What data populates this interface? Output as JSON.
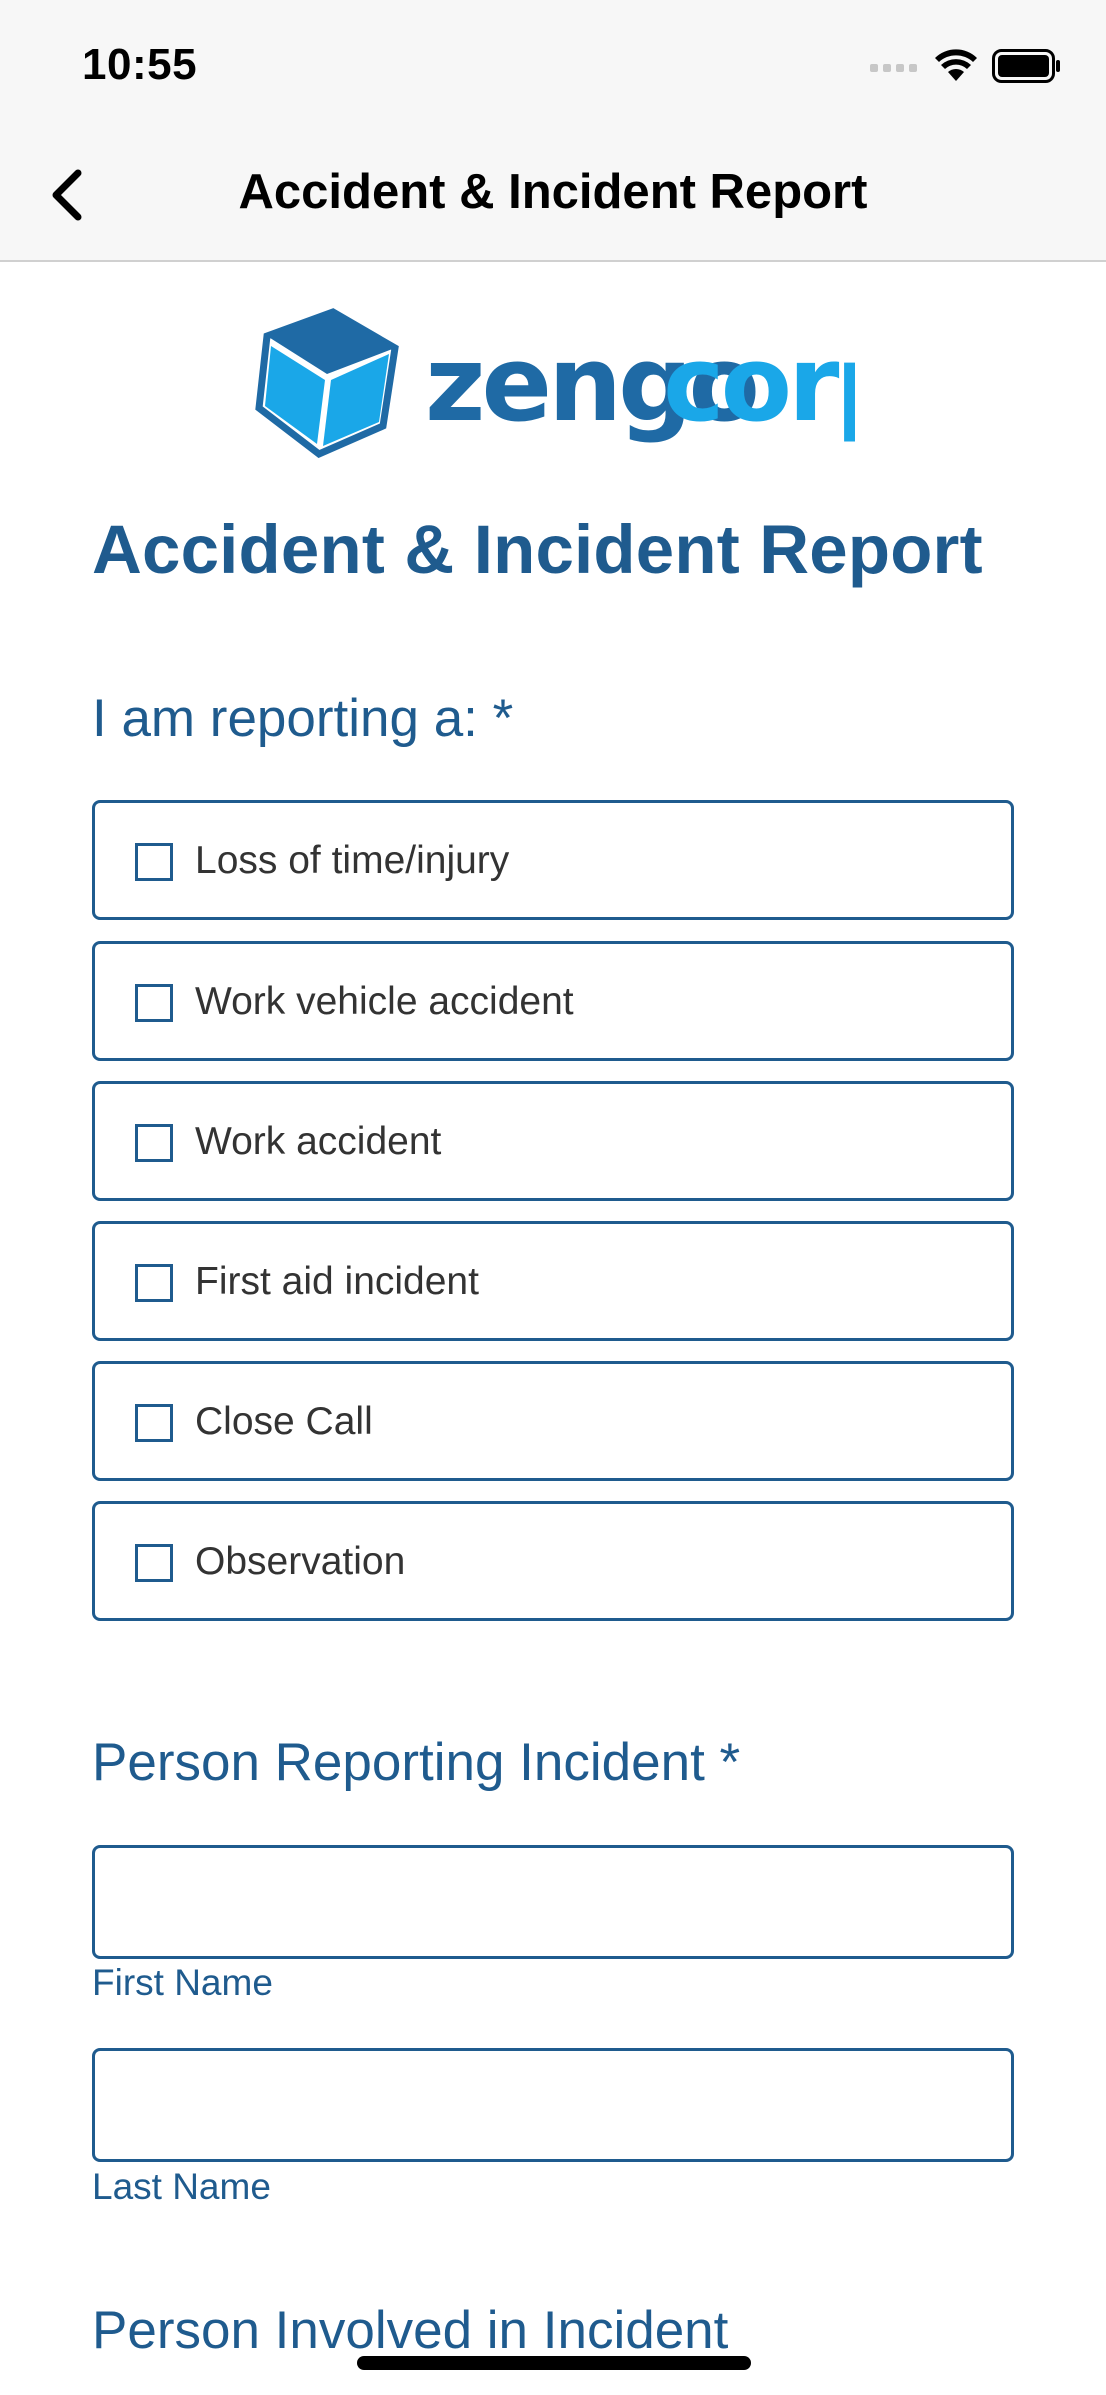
{
  "status": {
    "time": "10:55"
  },
  "nav": {
    "title": "Accident & Incident Report"
  },
  "logo": {
    "text_dark": "zengo",
    "text_light": "corp"
  },
  "colors": {
    "accent": "#1f5b8e",
    "logo_light": "#1aa7e8",
    "logo_dark": "#1f6aa5"
  },
  "page": {
    "title": "Accident & Incident Report"
  },
  "reporting": {
    "label": "I am reporting a: *",
    "options": [
      {
        "label": "Loss of time/injury",
        "checked": false
      },
      {
        "label": "Work vehicle accident",
        "checked": false
      },
      {
        "label": "Work accident",
        "checked": false
      },
      {
        "label": "First aid incident",
        "checked": false
      },
      {
        "label": "Close Call",
        "checked": false
      },
      {
        "label": "Observation",
        "checked": false
      }
    ]
  },
  "person_reporting": {
    "label": "Person Reporting Incident *",
    "first_name": {
      "value": "",
      "caption": "First Name"
    },
    "last_name": {
      "value": "",
      "caption": "Last Name"
    }
  },
  "person_involved": {
    "label": "Person Involved in Incident"
  }
}
